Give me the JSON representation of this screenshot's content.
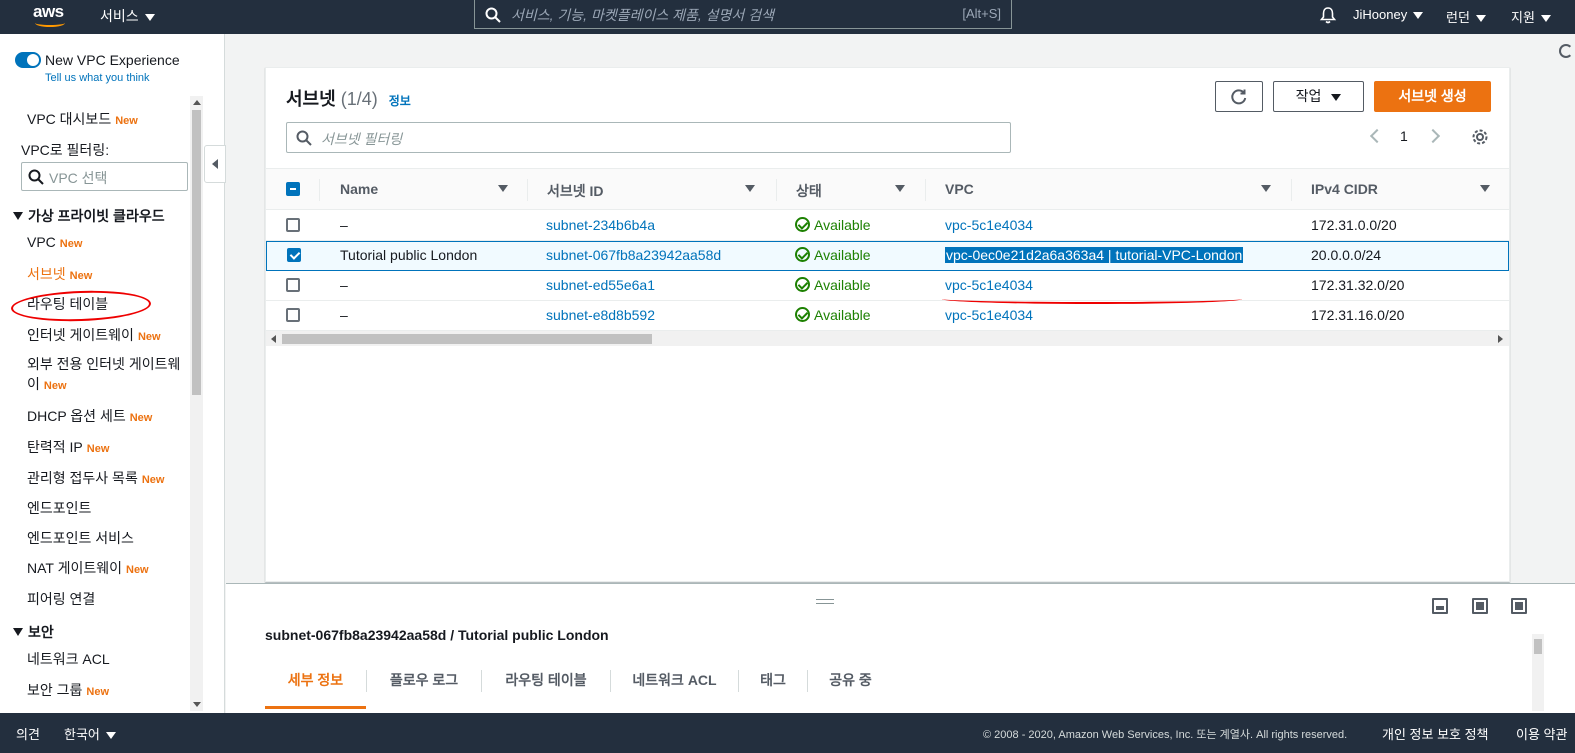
{
  "topnav": {
    "logo": "aws",
    "services": "서비스",
    "search_placeholder": "서비스, 기능, 마켓플레이스 제품, 설명서 검색",
    "search_shortcut": "[Alt+S]",
    "user": "JiHooney",
    "region": "런던",
    "support": "지원"
  },
  "sidebar": {
    "new_vpc_experience": "New VPC Experience",
    "tell_us": "Tell us what you think",
    "new_badge": "New",
    "vpc_dashboard": "VPC 대시보드",
    "vpc_filter_label": "VPC로 필터링:",
    "vpc_filter_placeholder": "VPC 선택",
    "section_vpc": "가상 프라이빗 클라우드",
    "section_security": "보안",
    "items": {
      "vpc": "VPC",
      "subnets": "서브넷",
      "route_tables": "라우팅 테이블",
      "igw": "인터넷 게이트웨이",
      "egress_igw": "외부 전용 인터넷 게이트웨이",
      "dhcp": "DHCP 옵션 세트",
      "eip": "탄력적 IP",
      "prefix_lists": "관리형 접두사 목록",
      "endpoints": "엔드포인트",
      "endpoint_services": "엔드포인트 서비스",
      "nat": "NAT 게이트웨이",
      "peering": "피어링 연결",
      "nacl": "네트워크 ACL",
      "security_groups": "보안 그룹"
    }
  },
  "panel": {
    "title": "서브넷",
    "count": "(1/4)",
    "info": "정보",
    "actions": "작업",
    "create": "서브넷 생성",
    "filter_placeholder": "서브넷 필터링",
    "page": "1",
    "columns": [
      "Name",
      "서브넷 ID",
      "상태",
      "VPC",
      "IPv4 CIDR"
    ],
    "rows": [
      {
        "name": "–",
        "id": "subnet-234b6b4a",
        "state": "Available",
        "vpc": "vpc-5c1e4034",
        "cidr": "172.31.0.0/20",
        "selected": false
      },
      {
        "name": "Tutorial public London",
        "id": "subnet-067fb8a23942aa58d",
        "state": "Available",
        "vpc": "vpc-0ec0e21d2a6a363a4 | tutorial-VPC-London",
        "cidr": "20.0.0.0/24",
        "selected": true
      },
      {
        "name": "–",
        "id": "subnet-ed55e6a1",
        "state": "Available",
        "vpc": "vpc-5c1e4034",
        "cidr": "172.31.32.0/20",
        "selected": false
      },
      {
        "name": "–",
        "id": "subnet-e8d8b592",
        "state": "Available",
        "vpc": "vpc-5c1e4034",
        "cidr": "172.31.16.0/20",
        "selected": false
      }
    ]
  },
  "details": {
    "title": "subnet-067fb8a23942aa58d / Tutorial public London",
    "tabs": [
      "세부 정보",
      "플로우 로그",
      "라우팅 테이블",
      "네트워크 ACL",
      "태그",
      "공유 중"
    ]
  },
  "footer": {
    "feedback": "의견",
    "language": "한국어",
    "copyright": "© 2008 - 2020, Amazon Web Services, Inc. 또는 계열사. All rights reserved.",
    "privacy": "개인 정보 보호 정책",
    "terms": "이용 약관"
  }
}
